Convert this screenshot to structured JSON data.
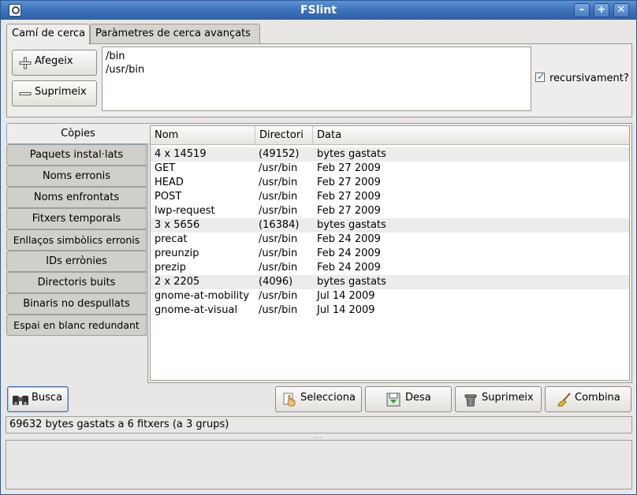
{
  "window": {
    "title": "FSlint",
    "minimize": "–",
    "maximize": "+",
    "close": "✕"
  },
  "top_tabs": [
    {
      "label": "Camí de cerca",
      "active": true
    },
    {
      "label": "Paràmetres de cerca avançats",
      "active": false
    }
  ],
  "search_path": {
    "add_label": "Afegeix",
    "remove_label": "Suprimeix",
    "paths": [
      "/bin",
      "/usr/bin"
    ],
    "recursive_label": "recursivament?",
    "recursive_checked": true
  },
  "side_tabs": [
    "Còpies",
    "Paquets instal·lats",
    "Noms erronis",
    "Noms enfrontats",
    "Fitxers temporals",
    "Enllaços simbòlics erronis",
    "IDs errònies",
    "Directoris buits",
    "Binaris no despullats",
    "Espai en blanc redundant"
  ],
  "results": {
    "columns": [
      "Nom",
      "Directori",
      "Data"
    ],
    "rows": [
      {
        "name": "4 x 14519",
        "dir": "(49152)",
        "date": "bytes gastats",
        "group": true
      },
      {
        "name": "GET",
        "dir": "/usr/bin",
        "date": "Feb 27 2009",
        "group": false
      },
      {
        "name": "HEAD",
        "dir": "/usr/bin",
        "date": "Feb 27 2009",
        "group": false
      },
      {
        "name": "POST",
        "dir": "/usr/bin",
        "date": "Feb 27 2009",
        "group": false
      },
      {
        "name": "lwp-request",
        "dir": "/usr/bin",
        "date": "Feb 27 2009",
        "group": false
      },
      {
        "name": "3 x 5656",
        "dir": "(16384)",
        "date": "bytes gastats",
        "group": true
      },
      {
        "name": "precat",
        "dir": "/usr/bin",
        "date": "Feb 24 2009",
        "group": false
      },
      {
        "name": "preunzip",
        "dir": "/usr/bin",
        "date": "Feb 24 2009",
        "group": false
      },
      {
        "name": "prezip",
        "dir": "/usr/bin",
        "date": "Feb 24 2009",
        "group": false
      },
      {
        "name": "2 x 2205",
        "dir": "(4096)",
        "date": "bytes gastats",
        "group": true
      },
      {
        "name": "gnome-at-mobility",
        "dir": "/usr/bin",
        "date": "Jul 14 2009",
        "group": false
      },
      {
        "name": "gnome-at-visual",
        "dir": "/usr/bin",
        "date": "Jul 14 2009",
        "group": false
      }
    ]
  },
  "actions": {
    "find": "Busca",
    "select": "Selecciona",
    "save": "Desa",
    "delete": "Suprimeix",
    "merge": "Combina"
  },
  "status": "69632 bytes gastats a 6 fitxers (a 3 grups)",
  "grip": "...",
  "colors": {
    "title_bar": "#3a6fb8",
    "accent": "#2b55a0",
    "window_bg": "#e8e7e5"
  }
}
